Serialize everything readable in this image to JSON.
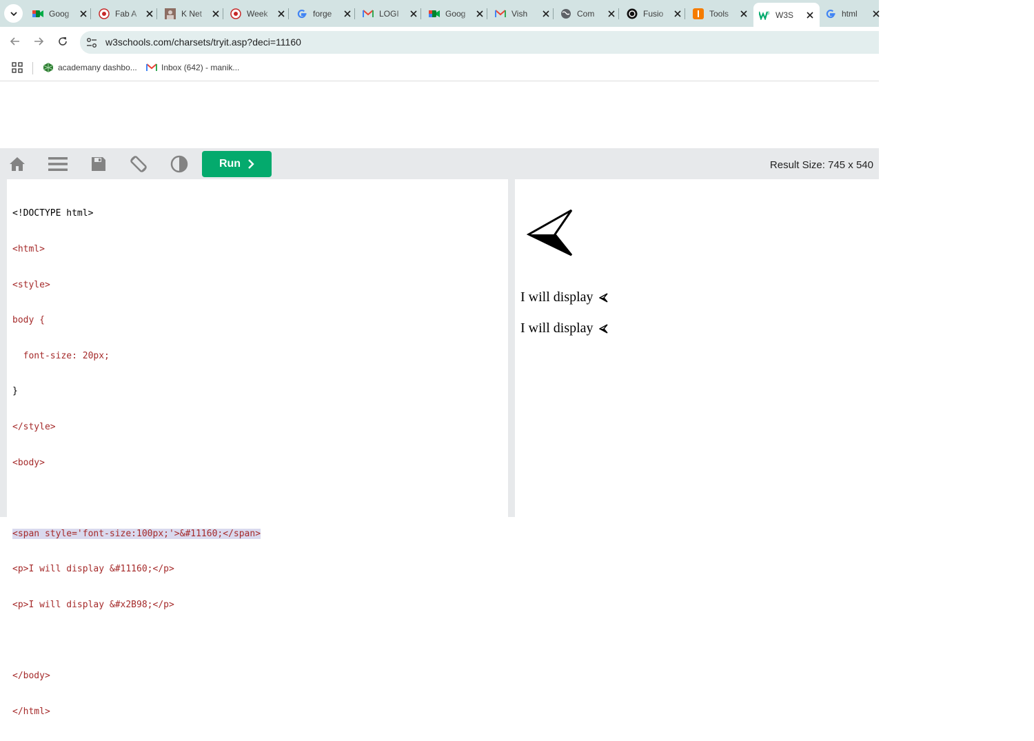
{
  "tabs": [
    {
      "title": "Goog",
      "icon": "google-meet-icon"
    },
    {
      "title": "Fab A",
      "icon": "fab-academy-icon"
    },
    {
      "title": "K Net",
      "icon": "profile-photo-icon"
    },
    {
      "title": "Week",
      "icon": "fab-academy-icon"
    },
    {
      "title": "forge",
      "icon": "google-icon"
    },
    {
      "title": "LOGI",
      "icon": "gmail-icon"
    },
    {
      "title": "Goog",
      "icon": "google-meet-icon"
    },
    {
      "title": "Vish",
      "icon": "gmail-icon"
    },
    {
      "title": "Com",
      "icon": "globe-icon"
    },
    {
      "title": "Fusio",
      "icon": "openai-icon"
    },
    {
      "title": "Tools",
      "icon": "tools-icon"
    },
    {
      "title": "W3S",
      "icon": "w3schools-icon",
      "active": true
    },
    {
      "title": "html",
      "icon": "google-icon"
    }
  ],
  "address_bar": {
    "url": "w3schools.com/charsets/tryit.asp?deci=11160"
  },
  "bookmarks": [
    {
      "label": "academany dashbo...",
      "icon": "academany-icon"
    },
    {
      "label": "Inbox (642) - manik...",
      "icon": "gmail-icon"
    }
  ],
  "w3_toolbar": {
    "run_label": "Run",
    "result_size": "Result Size: 745 x 540"
  },
  "code_lines": [
    "<!DOCTYPE html>",
    "<html>",
    "<style>",
    "body {",
    "  font-size: 20px;",
    "}",
    "</style>",
    "<body>",
    "",
    "<span style='font-size:100px;'>&#11160;</span>",
    "<p>I will display &#11160;</p>",
    "<p>I will display &#x2B98;</p>",
    "",
    "</body>",
    "</html>"
  ],
  "result": {
    "line1": "I will display",
    "line2": "I will display"
  },
  "colors": {
    "run_button": "#04aa6d",
    "toolbar_bg": "#e7e9eb",
    "tabstrip_bg": "#d3e3e3"
  }
}
